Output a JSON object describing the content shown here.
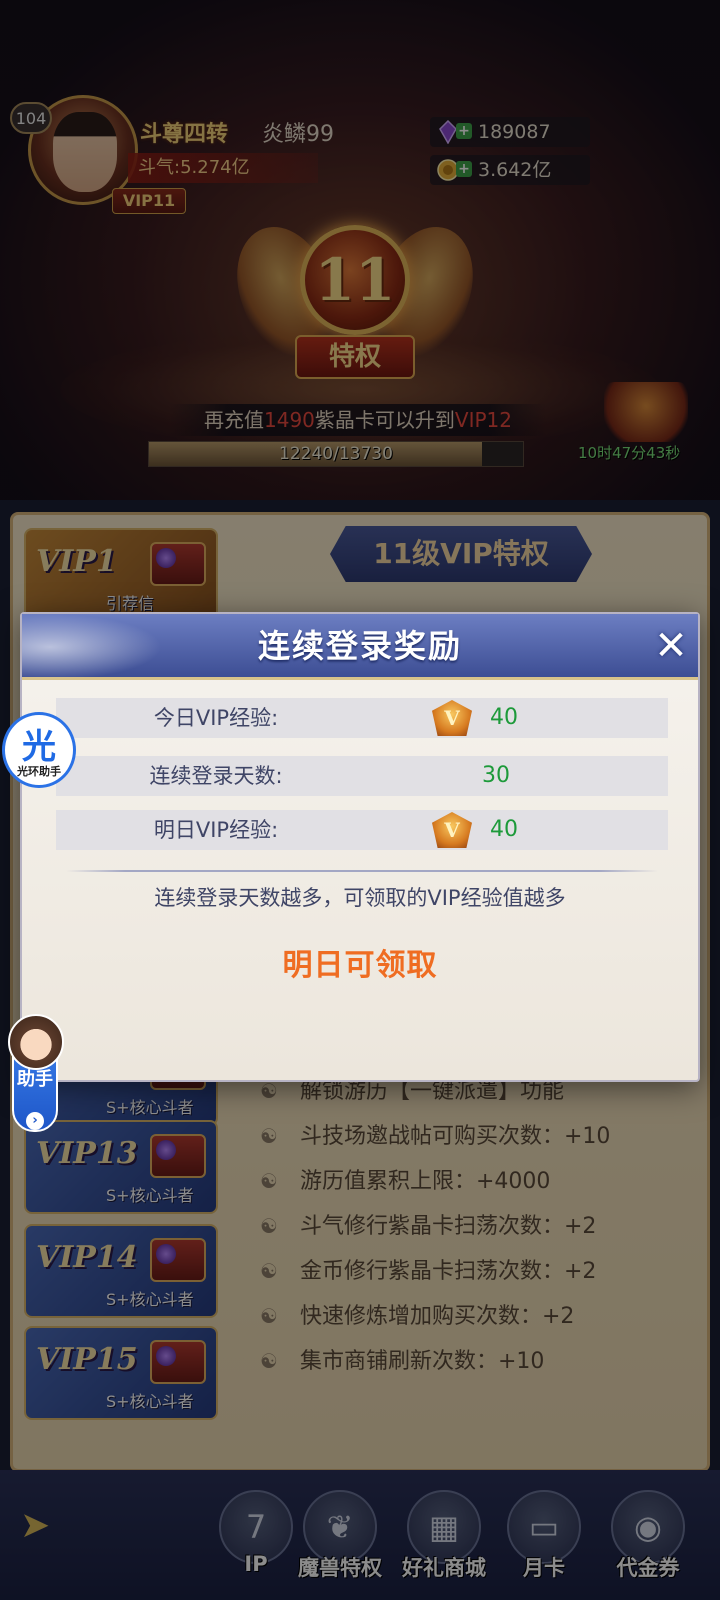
{
  "player": {
    "level": "104",
    "rank": "斗尊四转",
    "name": "炎鳞99",
    "power": "斗气:5.274亿",
    "vip": "VIP11"
  },
  "currencies": [
    {
      "icon": "purple-crystal-icon",
      "value": "189087"
    },
    {
      "icon": "gold-coin-icon",
      "value": "3.642亿"
    }
  ],
  "vip_emblem": {
    "level": "11",
    "label": "特权"
  },
  "upgrade": {
    "prefix": "再充值",
    "amount": "1490",
    "middle": "紫晶卡可以升到",
    "target": "VIP12",
    "progress_text": "12240/13730",
    "progress_ratio": 0.891
  },
  "gift_timer": "10时47分43秒",
  "panel": {
    "title": "11级VIP特权",
    "cards": [
      {
        "label": "VIP1",
        "sub": "引荐信"
      },
      {
        "label": "VIP13",
        "sub": "S+核心斗者"
      },
      {
        "label": "VIP14",
        "sub": "S+核心斗者"
      },
      {
        "label": "VIP15",
        "sub": "S+核心斗者"
      }
    ],
    "card_partial_sub": "S+核心斗者",
    "privileges": [
      "解锁游历【一键派遣】功能",
      "斗技场邀战帖可购买次数：+10",
      "游历值累积上限：+4000",
      "斗气修行紫晶卡扫荡次数：+2",
      "金币修行紫晶卡扫荡次数：+2",
      "快速修炼增加购买次数：+2",
      "集市商铺刷新次数：+10"
    ]
  },
  "bottom_nav": [
    {
      "label": "IP",
      "icon": "vip-icon"
    },
    {
      "label": "魔兽特权",
      "icon": "beast-icon"
    },
    {
      "label": "好礼商城",
      "icon": "shop-icon"
    },
    {
      "label": "月卡",
      "icon": "month-card-icon"
    },
    {
      "label": "代金券",
      "icon": "voucher-icon"
    }
  ],
  "modal": {
    "title": "连续登录奖励",
    "close": "✕",
    "rows": [
      {
        "label": "今日VIP经验:",
        "value": "40",
        "badge": "V"
      },
      {
        "label": "连续登录天数:",
        "value": "30"
      },
      {
        "label": "明日VIP经验:",
        "value": "40",
        "badge": "V"
      }
    ],
    "hint": "连续登录天数越多，可领取的VIP经验值越多",
    "claim": "明日可领取"
  },
  "floating": {
    "guang_char": "光",
    "guang_label": "光环助手",
    "helper_label": "助手",
    "helper_arrow": "›"
  },
  "colors": {
    "accent_green": "#1d9a3a",
    "claim_orange": "#ef6d22",
    "header_blue": "#4b5da4"
  }
}
